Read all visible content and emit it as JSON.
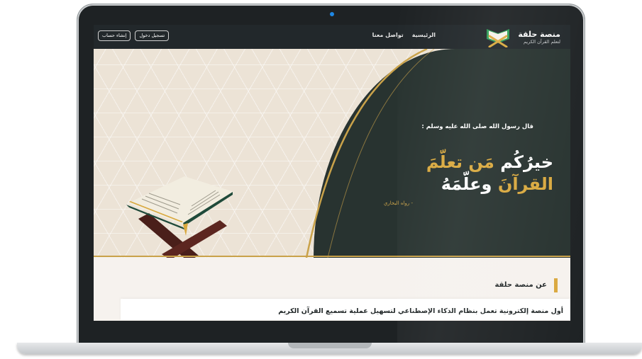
{
  "navbar": {
    "brand_name": "منصة حلقة",
    "brand_tagline": "لتعلم القرآن الكريم",
    "links": [
      "الرئيسية",
      "تواصل معنا"
    ],
    "login_label": "تسجيل دخول",
    "signup_label": "إنشاء حساب"
  },
  "hero": {
    "intro": "قال رسول الله صلى الله عليه وسلم :",
    "hadith_line1_white": "خيرُكُم",
    "hadith_line1_gold": "مَن تعلّمَ",
    "hadith_line2_gold": "القرآنَ",
    "hadith_line2_white": "وعلّمَهُ",
    "narrator": "- رواه البخاري"
  },
  "about": {
    "heading": "عن منصة حلقة",
    "description": "أول منصة إلكترونية تعمل بنظام الذكاء الإصطناعي لتسهيل عملية تسميع القرآن الكريم"
  },
  "icons": {
    "logo": "open-quran-book-icon",
    "illustration": "quran-on-stand-illustration"
  },
  "colors": {
    "navbar_bg": "#22282b",
    "hero_dark": "#283330",
    "accent_gold": "#d9a93f",
    "logo_green": "#2e9d57",
    "pattern_beige": "#ece3d6"
  }
}
